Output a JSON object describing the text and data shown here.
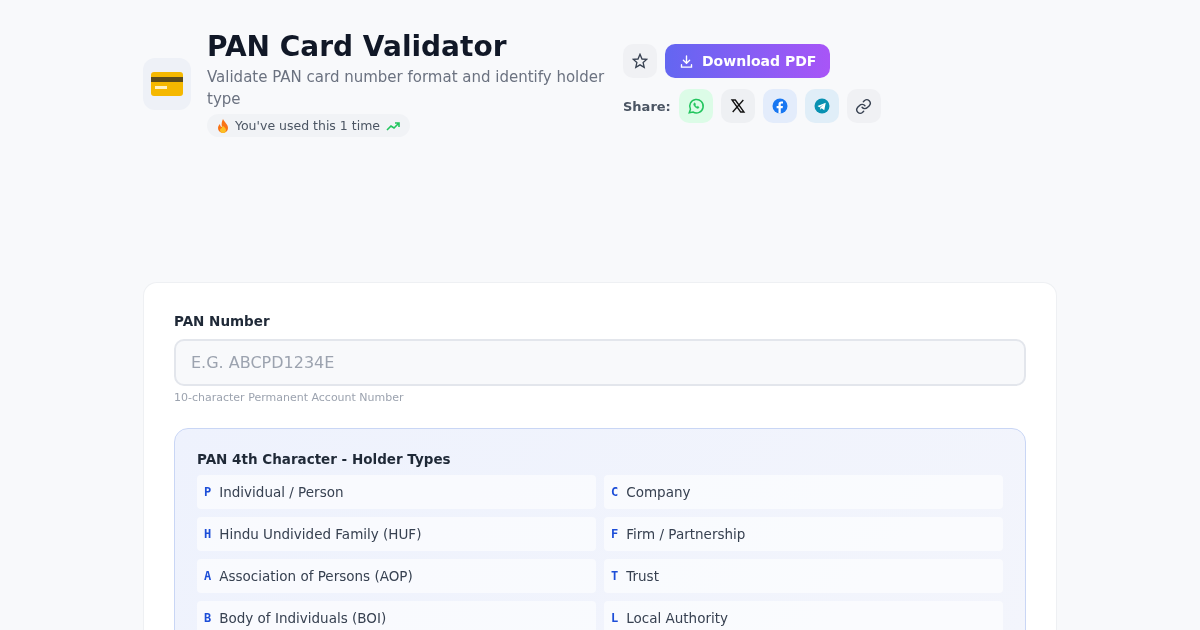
{
  "header": {
    "title": "PAN Card Validator",
    "subtitle": "Validate PAN card number format and identify holder type",
    "usage_badge": "You've used this 1 time"
  },
  "actions": {
    "favorite": {
      "selected": false
    },
    "download_button": "Download PDF",
    "share_label": "Share:",
    "share_buttons": [
      {
        "kind": "whatsapp"
      },
      {
        "kind": "x"
      },
      {
        "kind": "facebook"
      },
      {
        "kind": "telegram"
      },
      {
        "kind": "link"
      }
    ]
  },
  "form": {
    "label": "PAN Number",
    "placeholder": "E.G. ABCPD1234E",
    "hint": "10-character Permanent Account Number"
  },
  "holder_types": {
    "title": "PAN 4th Character - Holder Types",
    "items": [
      {
        "code": "P",
        "label": "Individual / Person"
      },
      {
        "code": "C",
        "label": "Company"
      },
      {
        "code": "H",
        "label": "Hindu Undivided Family (HUF)"
      },
      {
        "code": "F",
        "label": "Firm / Partnership"
      },
      {
        "code": "A",
        "label": "Association of Persons (AOP)"
      },
      {
        "code": "T",
        "label": "Trust"
      },
      {
        "code": "B",
        "label": "Body of Individuals (BOI)"
      },
      {
        "code": "L",
        "label": "Local Authority"
      }
    ]
  }
}
